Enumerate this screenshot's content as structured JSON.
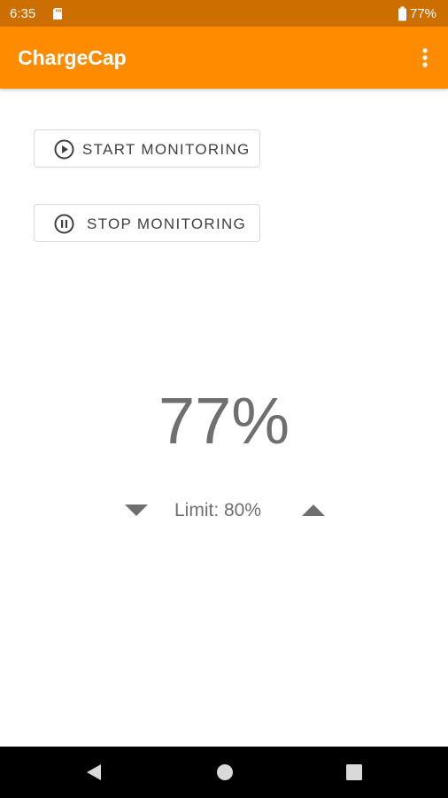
{
  "status_bar": {
    "time": "6:35",
    "battery": "77%",
    "sd_icon": "sd-card-icon",
    "battery_icon": "battery-icon"
  },
  "app_bar": {
    "title": "ChargeCap",
    "menu_icon": "more-vert-icon",
    "color": "#ff8c00",
    "status_color": "#cc6e00"
  },
  "buttons": {
    "start_label": "START MONITORING",
    "start_icon": "play-circle-icon",
    "stop_label": "STOP MONITORING",
    "stop_icon": "pause-circle-icon"
  },
  "battery_level": "77%",
  "limit": {
    "text": "Limit: 80%",
    "decrease_icon": "arrow-down-icon",
    "increase_icon": "arrow-up-icon"
  },
  "nav": {
    "back_icon": "back-triangle-icon",
    "home_icon": "home-circle-icon",
    "recents_icon": "recents-square-icon"
  }
}
